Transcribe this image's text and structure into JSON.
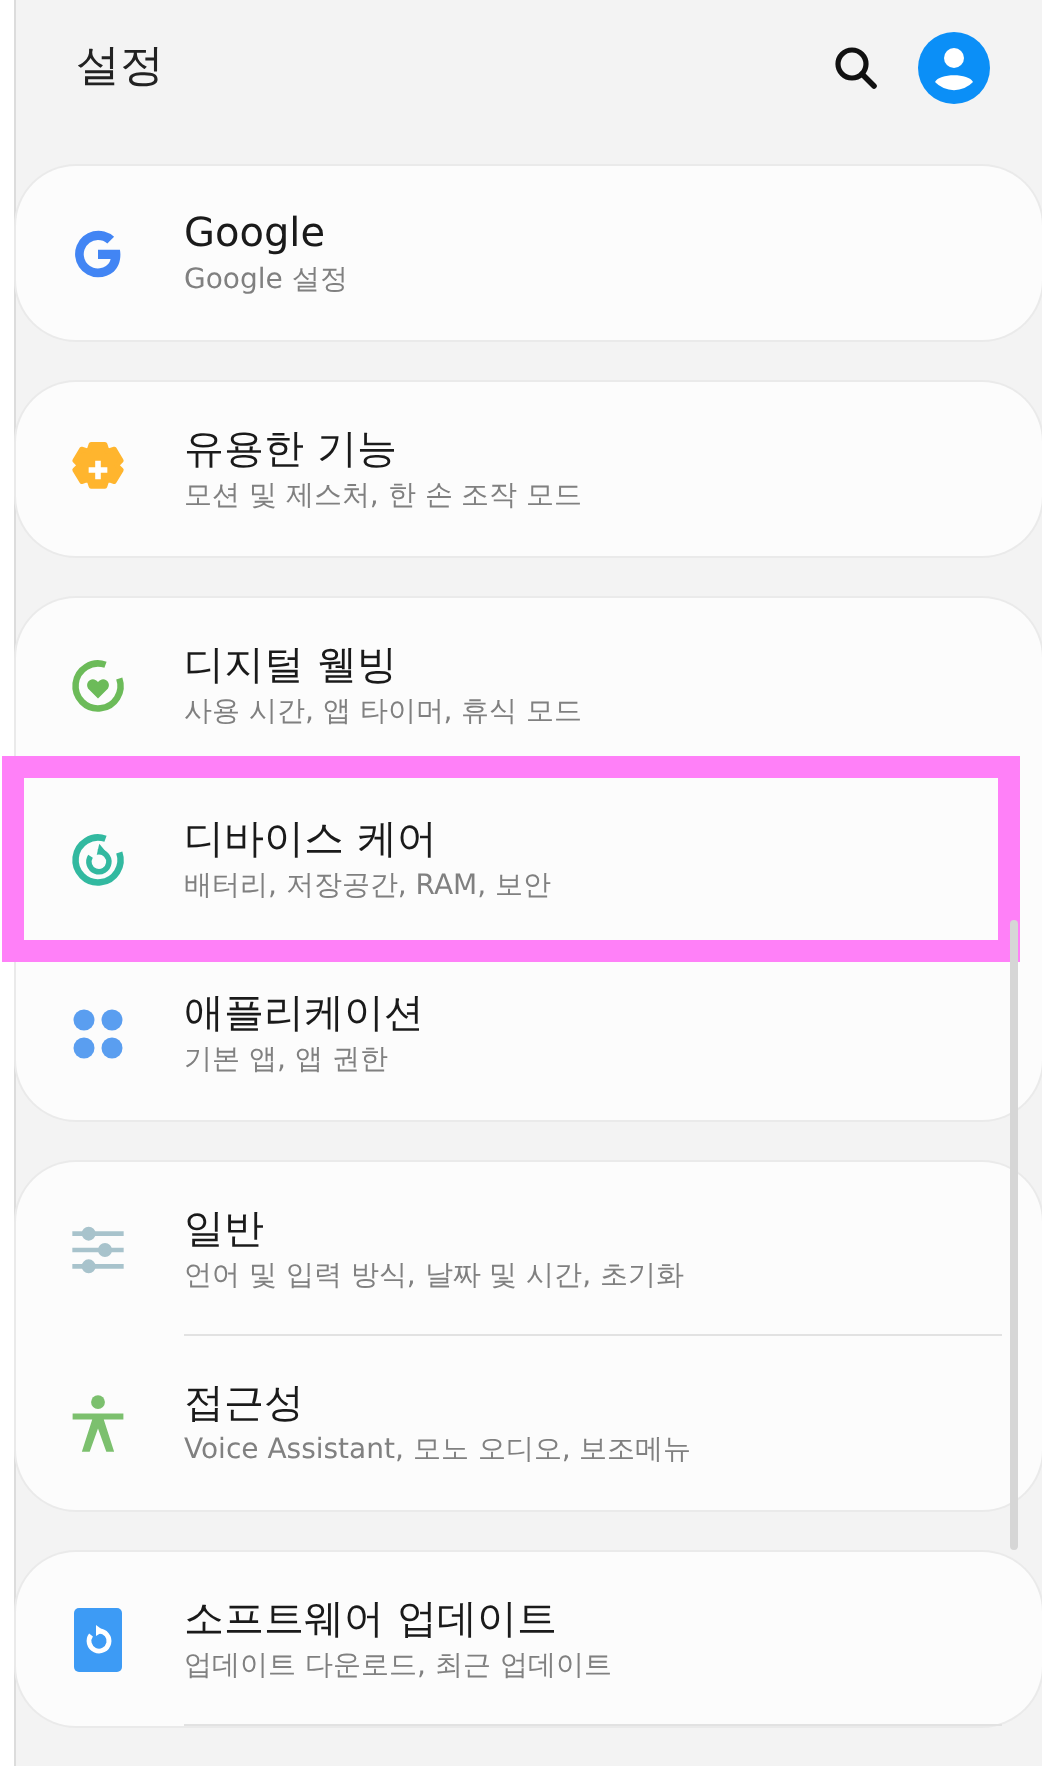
{
  "header": {
    "title": "설정"
  },
  "groups": [
    {
      "items": [
        {
          "title": "Google",
          "subtitle": "Google 설정",
          "highlighted": false
        }
      ]
    },
    {
      "items": [
        {
          "title": "유용한 기능",
          "subtitle": "모션 및 제스처, 한 손 조작 모드",
          "highlighted": false
        }
      ]
    },
    {
      "items": [
        {
          "title": "디지털 웰빙",
          "subtitle": "사용 시간, 앱 타이머, 휴식 모드",
          "highlighted": false
        },
        {
          "title": "디바이스 케어",
          "subtitle": "배터리, 저장공간, RAM, 보안",
          "highlighted": true
        },
        {
          "title": "애플리케이션",
          "subtitle": "기본 앱, 앱 권한",
          "highlighted": false
        }
      ]
    },
    {
      "items": [
        {
          "title": "일반",
          "subtitle": "언어 및 입력 방식, 날짜 및 시간, 초기화",
          "highlighted": false
        },
        {
          "title": "접근성",
          "subtitle": "Voice Assistant, 모노 오디오, 보조메뉴",
          "highlighted": false
        }
      ]
    },
    {
      "items": [
        {
          "title": "소프트웨어 업데이트",
          "subtitle": "업데이트 다운로드, 최근 업데이트",
          "highlighted": false
        }
      ]
    }
  ]
}
